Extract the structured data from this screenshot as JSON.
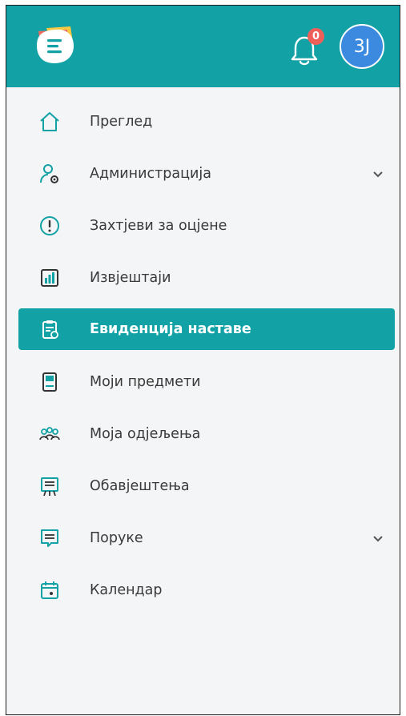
{
  "header": {
    "notifications_count": "0",
    "avatar_initials": "3J"
  },
  "colors": {
    "primary": "#12a2a5",
    "badge": "#ef5f5a",
    "avatar": "#3b8ae0"
  },
  "menu": [
    {
      "label": "Преглед",
      "icon": "home-icon"
    },
    {
      "label": "Администрација",
      "icon": "user-gear-icon",
      "expandable": true
    },
    {
      "label": "Захтјеви за оцјене",
      "icon": "exclamation-circle-icon"
    },
    {
      "label": "Извјештаји",
      "icon": "bar-chart-icon"
    },
    {
      "label": "Евиденција наставе",
      "icon": "clipboard-check-icon",
      "active": true
    },
    {
      "label": "Моји предмети",
      "icon": "book-icon"
    },
    {
      "label": "Моја одјељења",
      "icon": "group-icon"
    },
    {
      "label": "Обавјештења",
      "icon": "presentation-board-icon"
    },
    {
      "label": "Поруке",
      "icon": "message-icon",
      "expandable": true
    },
    {
      "label": "Календар",
      "icon": "calendar-icon"
    }
  ]
}
